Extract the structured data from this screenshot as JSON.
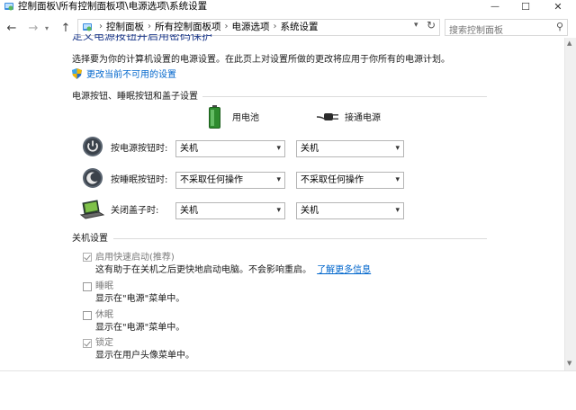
{
  "window": {
    "title": "控制面板\\所有控制面板项\\电源选项\\系统设置",
    "minimize": "—",
    "maximize": "☐",
    "close": "✕"
  },
  "address": {
    "crumbs": [
      "控制面板",
      "所有控制面板项",
      "电源选项",
      "系统设置"
    ],
    "search_placeholder": "搜索控制面板"
  },
  "page": {
    "heading_partial": "定义电源按钮并启用密码保护",
    "intro": "选择要为你的计算机设置的电源设置。在此页上对设置所做的更改将应用于你所有的电源计划。",
    "admin_link": "更改当前不可用的设置"
  },
  "buttons_section": {
    "title": "电源按钮、睡眠按钮和盖子设置",
    "col_battery": "用电池",
    "col_plugged": "接通电源",
    "rows": [
      {
        "label": "按电源按钮时:",
        "battery": "关机",
        "plugged": "关机",
        "icon": "power-icon"
      },
      {
        "label": "按睡眠按钮时:",
        "battery": "不采取任何操作",
        "plugged": "不采取任何操作",
        "icon": "sleep-icon"
      },
      {
        "label": "关闭盖子时:",
        "battery": "关机",
        "plugged": "关机",
        "icon": "laptop-lid-icon"
      }
    ]
  },
  "shutdown_section": {
    "title": "关机设置",
    "items": [
      {
        "label": "启用快速启动(推荐)",
        "desc": "这有助于在关机之后更快地启动电脑。不会影响重启。",
        "link": "了解更多信息",
        "checked": true
      },
      {
        "label": "睡眠",
        "desc": "显示在\"电源\"菜单中。",
        "checked": false
      },
      {
        "label": "休眠",
        "desc": "显示在\"电源\"菜单中。",
        "checked": false
      },
      {
        "label": "锁定",
        "desc": "显示在用户头像菜单中。",
        "checked": true
      }
    ]
  },
  "colors": {
    "link": "#0066cc",
    "text": "#1a1a1a",
    "disabled": "#7a7a7a"
  }
}
